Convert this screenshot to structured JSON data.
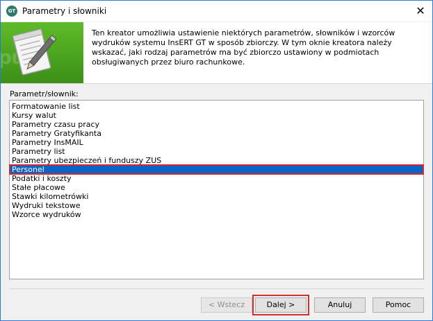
{
  "window": {
    "title": "Parametry i słowniki",
    "app_icon_text": "GT",
    "close_glyph": "✕"
  },
  "header": {
    "description": "Ten kreator umożliwia ustawienie niektórych parametrów, słowników i wzorców wydruków systemu InsERT GT w sposób zbiorczy. W tym oknie kreatora należy wskazać, jaki rodzaj parametrów ma być zbiorczo ustawiony w podmiotach obsługiwanych przez biuro rachunkowe.",
    "logo_icon": "notepad-pencil-icon",
    "logo_color": "#48a21d"
  },
  "list": {
    "label": "Parametr/słownik:",
    "selected_index": 7,
    "selection_color": "#0a64c6",
    "highlight_color": "#d62b2b",
    "items": [
      "Formatowanie list",
      "Kursy walut",
      "Parametry czasu pracy",
      "Parametry Gratyfikanta",
      "Parametry InsMAIL",
      "Parametry list",
      "Parametry ubezpieczeń i funduszy ZUS",
      "Personel",
      "Podatki i koszty",
      "Stałe płacowe",
      "Stawki kilometrówki",
      "Wydruki tekstowe",
      "Wzorce wydruków"
    ]
  },
  "buttons": {
    "back": "< Wstecz",
    "next": "Dalej >",
    "cancel": "Anuluj",
    "help": "Pomoc"
  }
}
